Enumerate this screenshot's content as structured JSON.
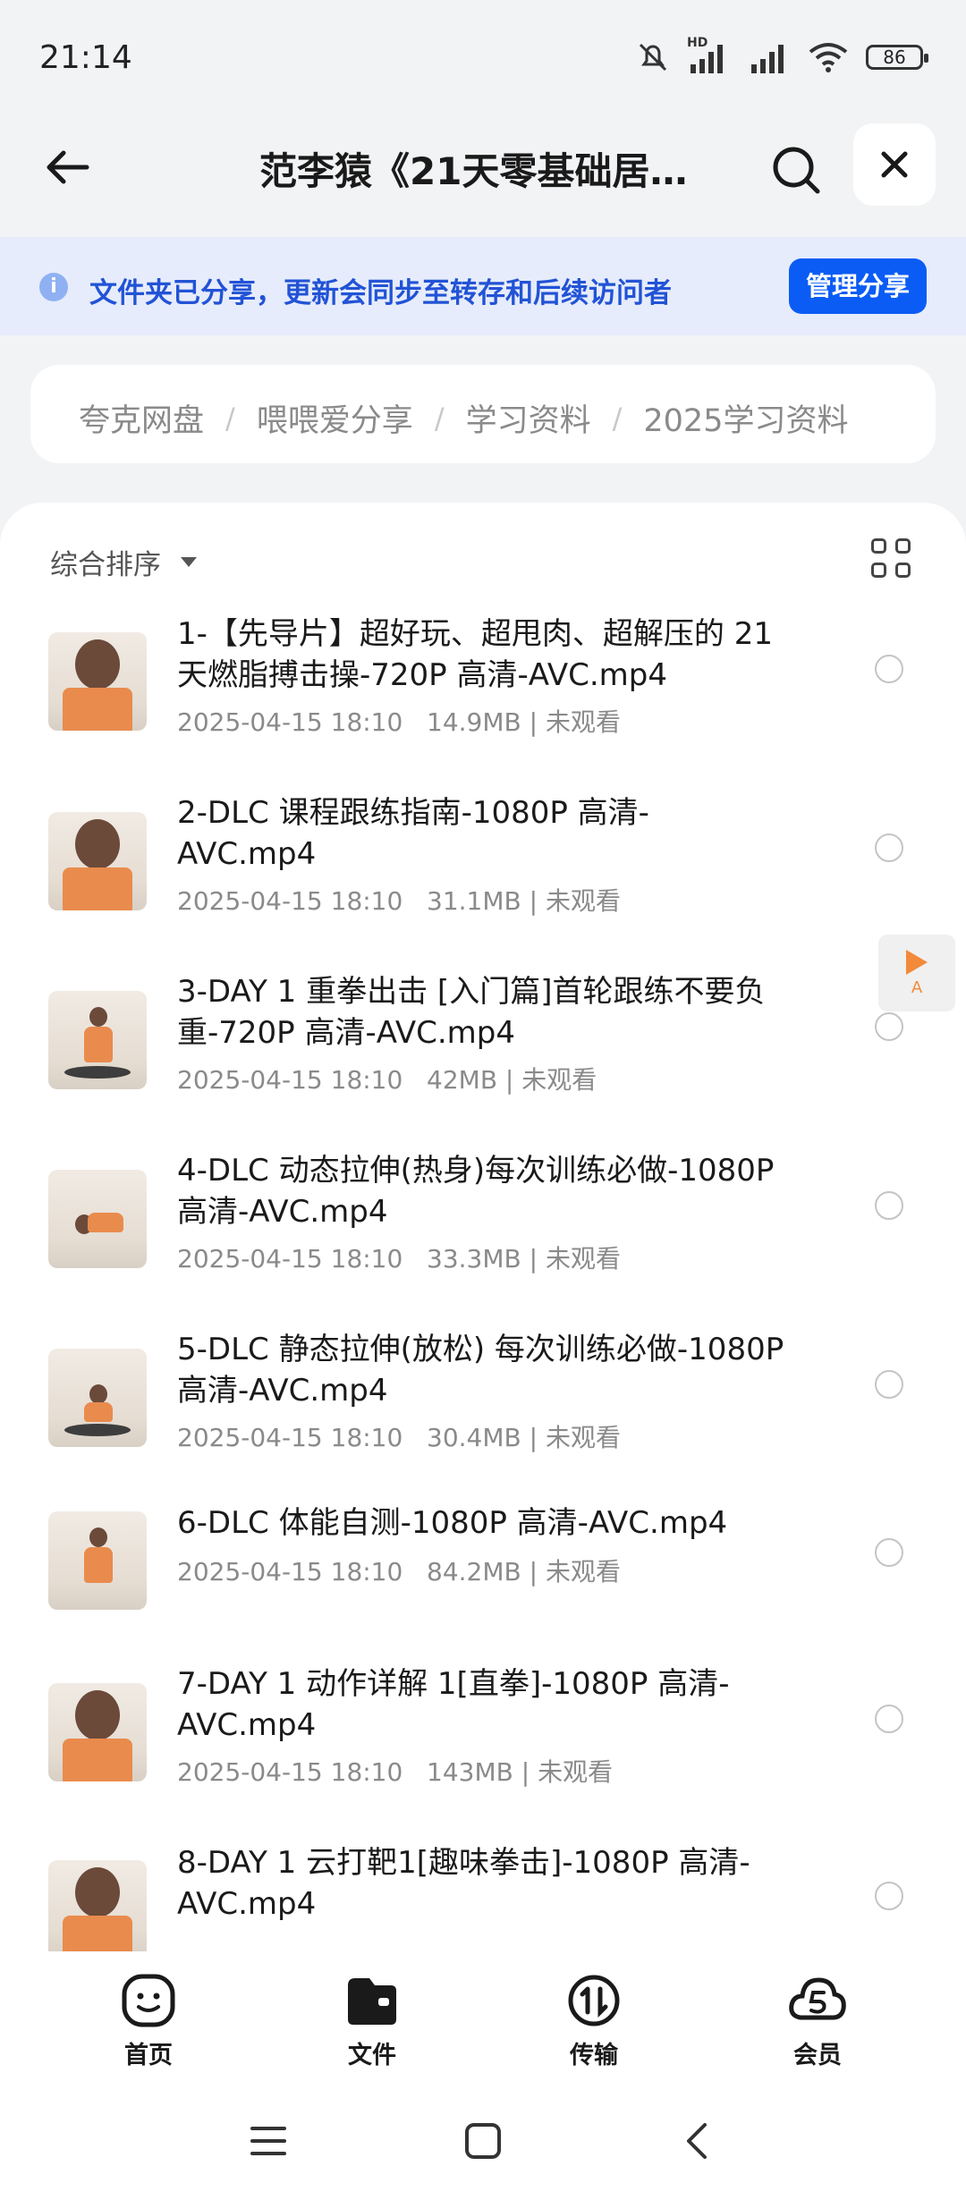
{
  "status_bar": {
    "time": "21:14",
    "battery": "86",
    "network_tag": "HD"
  },
  "header": {
    "title": "范李猿《21天零基础居…"
  },
  "share_banner": {
    "info_symbol": "i",
    "text": "文件夹已分享，更新会同步至转存和后续访问者",
    "button": "管理分享"
  },
  "breadcrumb": [
    "夸克网盘",
    "喂喂爱分享",
    "学习资料",
    "2025学习资料"
  ],
  "breadcrumb_separator": "/",
  "sort": {
    "label": "综合排序"
  },
  "files": [
    {
      "name": "1-【先导片】超好玩、超甩肉、超解压的 21天燃脂搏击操-720P 高清-AVC.mp4",
      "date": "2025-04-15 18:10",
      "size": "14.9MB",
      "status": "未观看",
      "thumb": "close"
    },
    {
      "name": "2-DLC 课程跟练指南-1080P 高清-AVC.mp4",
      "date": "2025-04-15 18:10",
      "size": "31.1MB",
      "status": "未观看",
      "thumb": "close"
    },
    {
      "name": "3-DAY 1 重拳出击 [入门篇]首轮跟练不要负重-720P 高清-AVC.mp4",
      "date": "2025-04-15 18:10",
      "size": "42MB",
      "status": "未观看",
      "thumb": "full"
    },
    {
      "name": "4-DLC 动态拉伸(热身)每次训练必做-1080P 高清-AVC.mp4",
      "date": "2025-04-15 18:10",
      "size": "33.3MB",
      "status": "未观看",
      "thumb": "full"
    },
    {
      "name": "5-DLC 静态拉伸(放松) 每次训练必做-1080P 高清-AVC.mp4",
      "date": "2025-04-15 18:10",
      "size": "30.4MB",
      "status": "未观看",
      "thumb": "full"
    },
    {
      "name": "6-DLC 体能自测-1080P 高清-AVC.mp4",
      "date": "2025-04-15 18:10",
      "size": "84.2MB",
      "status": "未观看",
      "thumb": "full"
    },
    {
      "name": "7-DAY 1 动作详解 1[直拳]-1080P 高清-AVC.mp4",
      "date": "2025-04-15 18:10",
      "size": "143MB",
      "status": "未观看",
      "thumb": "close"
    },
    {
      "name": "8-DAY 1 云打靶1[趣味拳击]-1080P 高清-AVC.mp4",
      "date": "",
      "size": "",
      "status": "",
      "thumb": "close"
    }
  ],
  "float_badge": {
    "label": "A"
  },
  "tabs": [
    "首页",
    "文件",
    "传输",
    "会员"
  ],
  "colors": {
    "accent": "#0a5cf5",
    "banner_bg": "#e6ecfb",
    "banner_text": "#2253d6"
  },
  "icons": [
    "back-arrow-icon",
    "search-icon",
    "close-icon",
    "info-icon",
    "grid-view-icon",
    "home-icon",
    "folder-icon",
    "transfer-icon",
    "member-icon",
    "menu-icon",
    "home-square-icon",
    "back-chevron-icon"
  ]
}
